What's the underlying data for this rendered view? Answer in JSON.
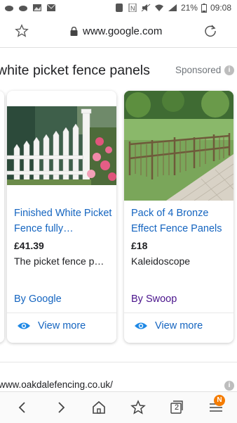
{
  "status_bar": {
    "battery": "21%",
    "time": "09:08"
  },
  "browser": {
    "url": "www.google.com"
  },
  "ads": {
    "heading": "white picket fence panels",
    "sponsored_label": "Sponsored",
    "cards": [
      {
        "title": "Finished White Picket Fence fully…",
        "price": "£41.39",
        "description": "The picket fence p…",
        "seller": "By Google",
        "view_more": "View more"
      },
      {
        "title": "Pack of 4 Bronze Effect Fence Panels",
        "price": "£18",
        "description": "Kaleidoscope",
        "seller": "By Swoop",
        "view_more": "View more"
      }
    ]
  },
  "result": {
    "url": "www.oakdalefencing.co.uk/"
  },
  "bottom_nav": {
    "tab_count": "2",
    "menu_badge": "N"
  },
  "colors": {
    "link": "#1565c0",
    "visited": "#4a148c",
    "badge": "#f57c00"
  }
}
